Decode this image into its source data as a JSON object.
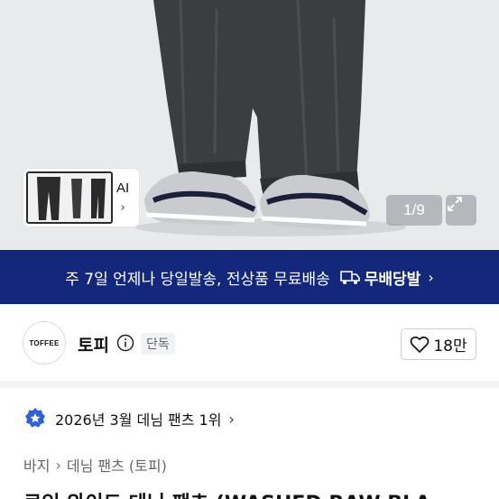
{
  "hero": {
    "thumbnail_label": "AI",
    "counter": "1/9"
  },
  "banner": {
    "text": "주 7일 언제나 당일발송, 전상품 무료배송",
    "service": "무배당발"
  },
  "brand": {
    "logo_text": "TOFFEE",
    "name": "토피",
    "badge": "단독",
    "likes": "18만"
  },
  "ranking": {
    "text": "2026년 3월 데님 팬츠 1위"
  },
  "breadcrumb": {
    "items": [
      "바지",
      "데님 팬츠 (토피)"
    ]
  },
  "product": {
    "title_partial": "로인 와이드 데님 팬츠 (WASHED RAW BLA"
  },
  "colors": {
    "banner_bg": "#13287a",
    "rank_badge": "#2e62d9"
  }
}
